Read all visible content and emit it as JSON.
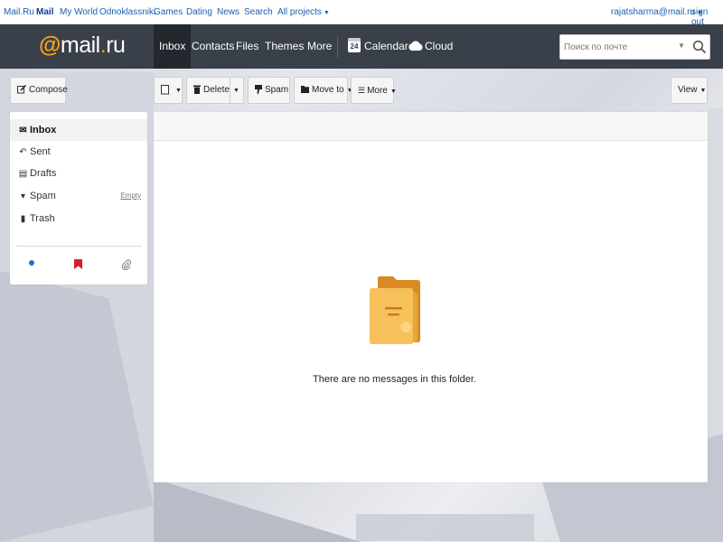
{
  "portal": {
    "links": [
      "Mail.Ru",
      "Mail",
      "My World",
      "Odnoklassniki",
      "Games",
      "Dating",
      "News",
      "Search",
      "All projects"
    ],
    "account": "rajatsharma@mail.ru",
    "signout": "sign out"
  },
  "header": {
    "logo": {
      "at": "@",
      "name": "mail",
      "dot": ".",
      "tld": "ru"
    },
    "nav": [
      "Inbox",
      "Contacts",
      "Files",
      "Themes",
      "More",
      "Calendar",
      "Cloud"
    ],
    "calendar_day": "24",
    "search_placeholder": "Поиск по почте"
  },
  "toolbar": {
    "compose": "Compose",
    "delete": "Delete",
    "spam": "Spam",
    "move_to": "Move to",
    "more": "More",
    "view": "View"
  },
  "folders": {
    "items": [
      {
        "label": "Inbox",
        "icon": "envelope-icon"
      },
      {
        "label": "Sent",
        "icon": "reply-icon"
      },
      {
        "label": "Drafts",
        "icon": "draft-icon"
      },
      {
        "label": "Spam",
        "icon": "thumbs-down-icon"
      },
      {
        "label": "Trash",
        "icon": "trash-icon"
      }
    ],
    "empty_link": "Empty",
    "filter_icons": [
      "unread-dot-icon",
      "flag-icon",
      "attachment-icon"
    ]
  },
  "messages": {
    "empty_text": "There are no messages in this folder."
  },
  "colors": {
    "header_bg": "#394049",
    "logo_accent": "#f7a21b",
    "link": "#1a5fae",
    "folder_yellow": "#f6c15a",
    "folder_orange": "#d98a23",
    "flag_red": "#d81e2b",
    "unread_blue": "#1c6fd6"
  }
}
